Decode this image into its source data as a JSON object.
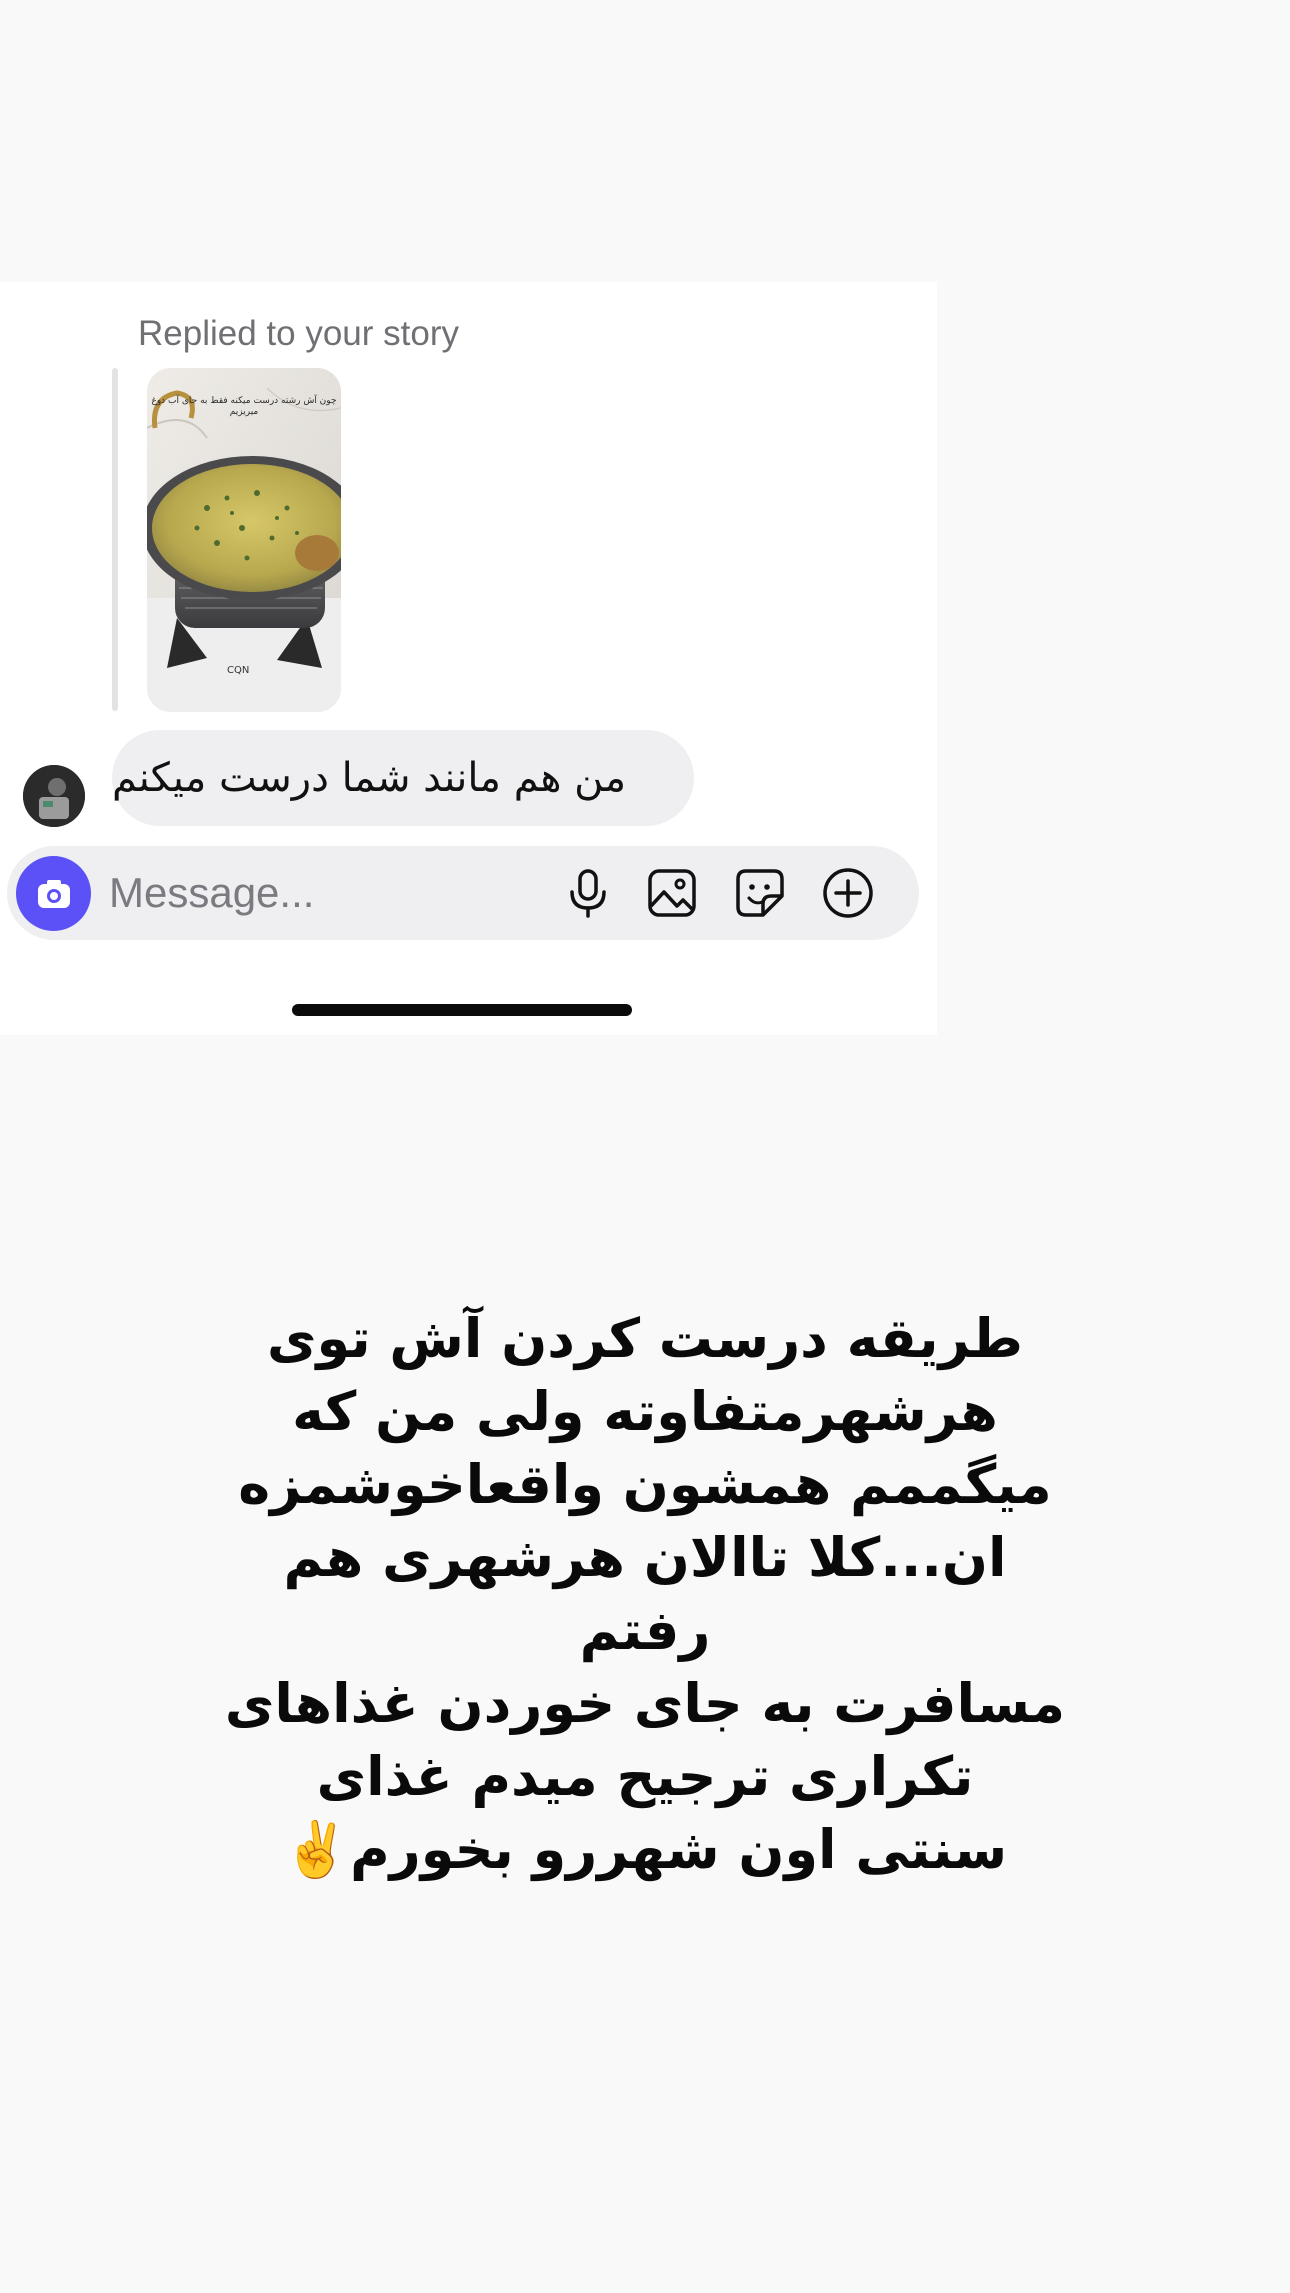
{
  "thread": {
    "replied_label": "Replied to your story",
    "story_caption": "چون آش رشته درست میکنه فقط به جای آب دوغ میریزیم",
    "message_text": "من هم مانند شما درست میکنم"
  },
  "composer": {
    "placeholder": "Message...",
    "camera_icon": "camera-icon",
    "mic_icon": "microphone-icon",
    "gallery_icon": "gallery-icon",
    "sticker_icon": "sticker-icon",
    "plus_icon": "plus-circle-icon"
  },
  "story_text": "طریقه درست کردن آش توی\nهرشهرمتفاوته ولی من که\nمیگممم همشون واقعاخوشمزه\nان...کلا تاالان هرشهری هم رفتم\nمسافرت به جای خوردن غذاهای\nتکراری ترجیح میدم غذای\nسنتی اون شهررو بخورم✌️",
  "colors": {
    "accent": "#5b51f6",
    "bubble": "#efeff1",
    "background": "#f9f9f9"
  }
}
